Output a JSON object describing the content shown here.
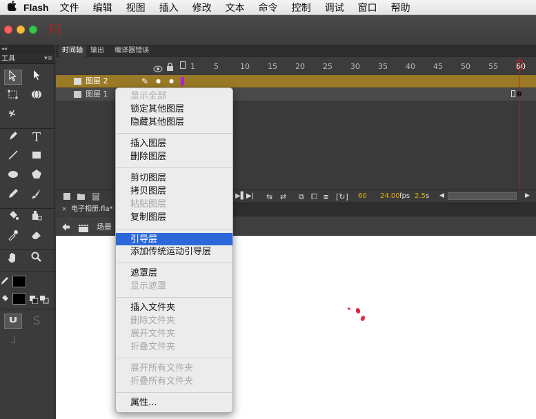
{
  "menubar": {
    "app_name": "Flash",
    "items": [
      "文件",
      "编辑",
      "视图",
      "插入",
      "修改",
      "文本",
      "命令",
      "控制",
      "调试",
      "窗口",
      "帮助"
    ]
  },
  "window": {
    "logo": "Fl"
  },
  "tools_panel": {
    "title": "工具"
  },
  "timeline": {
    "tabs": [
      "时间轴",
      "输出",
      "编译器错误"
    ],
    "ruler": [
      "1",
      "5",
      "10",
      "15",
      "20",
      "25",
      "30",
      "35",
      "40",
      "45",
      "50",
      "55",
      "60"
    ],
    "layers": [
      {
        "name": "图层 2",
        "selected": true
      },
      {
        "name": "图层 1",
        "selected": false
      }
    ],
    "status": {
      "current_frame": "60",
      "fps": "24.00",
      "fps_unit": "fps",
      "time": "2.5",
      "time_unit": "s"
    }
  },
  "document": {
    "tab_title": "电子相册.fla*",
    "scene_label": "场景"
  },
  "context_menu": {
    "items": [
      {
        "label": "显示全部",
        "disabled": true
      },
      {
        "label": "锁定其他图层",
        "disabled": false
      },
      {
        "label": "隐藏其他图层",
        "disabled": false
      },
      {
        "label": "插入图层",
        "disabled": false
      },
      {
        "label": "删除图层",
        "disabled": false
      },
      {
        "label": "剪切图层",
        "disabled": false
      },
      {
        "label": "拷贝图层",
        "disabled": false
      },
      {
        "label": "粘贴图层",
        "disabled": true
      },
      {
        "label": "复制图层",
        "disabled": false
      },
      {
        "label": "引导层",
        "disabled": false,
        "highlighted": true
      },
      {
        "label": "添加传统运动引导层",
        "disabled": false
      },
      {
        "label": "遮罩层",
        "disabled": false
      },
      {
        "label": "显示遮罩",
        "disabled": true
      },
      {
        "label": "插入文件夹",
        "disabled": false
      },
      {
        "label": "删除文件夹",
        "disabled": true
      },
      {
        "label": "展开文件夹",
        "disabled": true
      },
      {
        "label": "折叠文件夹",
        "disabled": true
      },
      {
        "label": "展开所有文件夹",
        "disabled": true
      },
      {
        "label": "折叠所有文件夹",
        "disabled": true
      },
      {
        "label": "属性...",
        "disabled": false
      }
    ]
  },
  "colors": {
    "selected_layer": "#9a7a26",
    "playhead": "#c02020",
    "menu_highlight": "#2c68d9",
    "frame_rate": "#e8b100"
  }
}
